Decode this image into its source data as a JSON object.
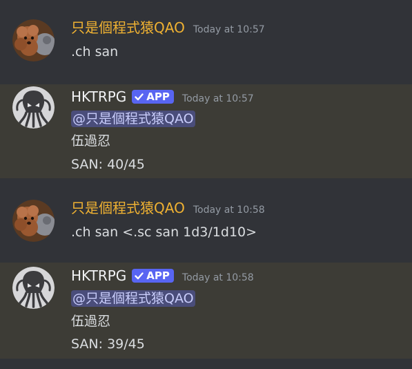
{
  "colors": {
    "background": "#313338",
    "highlight_background": "#3d3c36",
    "user_name": "#f0b232",
    "bot_name": "#f2f3f5",
    "app_badge": "#5865f2",
    "mention_bg": "#4a4d7a",
    "mention_text": "#c9cdfb",
    "timestamp": "#949ba4",
    "message_text": "#dbdee1"
  },
  "messages": [
    {
      "author": "只是個程式猿QAO",
      "avatar": "poodle-avatar-icon",
      "timestamp": "Today at 10:57",
      "lines": [
        ".ch san"
      ]
    },
    {
      "author": "HKTRPG",
      "avatar": "cthulhu-avatar-icon",
      "badge": "APP",
      "timestamp": "Today at 10:57",
      "mention": "@只是個程式猿QAO",
      "lines": [
        "伍過忍",
        "SAN: 40/45"
      ]
    },
    {
      "author": "只是個程式猿QAO",
      "avatar": "poodle-avatar-icon",
      "timestamp": "Today at 10:58",
      "lines": [
        ".ch san <.sc san 1d3/1d10>"
      ]
    },
    {
      "author": "HKTRPG",
      "avatar": "cthulhu-avatar-icon",
      "badge": "APP",
      "timestamp": "Today at 10:58",
      "mention": "@只是個程式猿QAO",
      "lines": [
        "伍過忍",
        "SAN: 39/45"
      ]
    }
  ]
}
